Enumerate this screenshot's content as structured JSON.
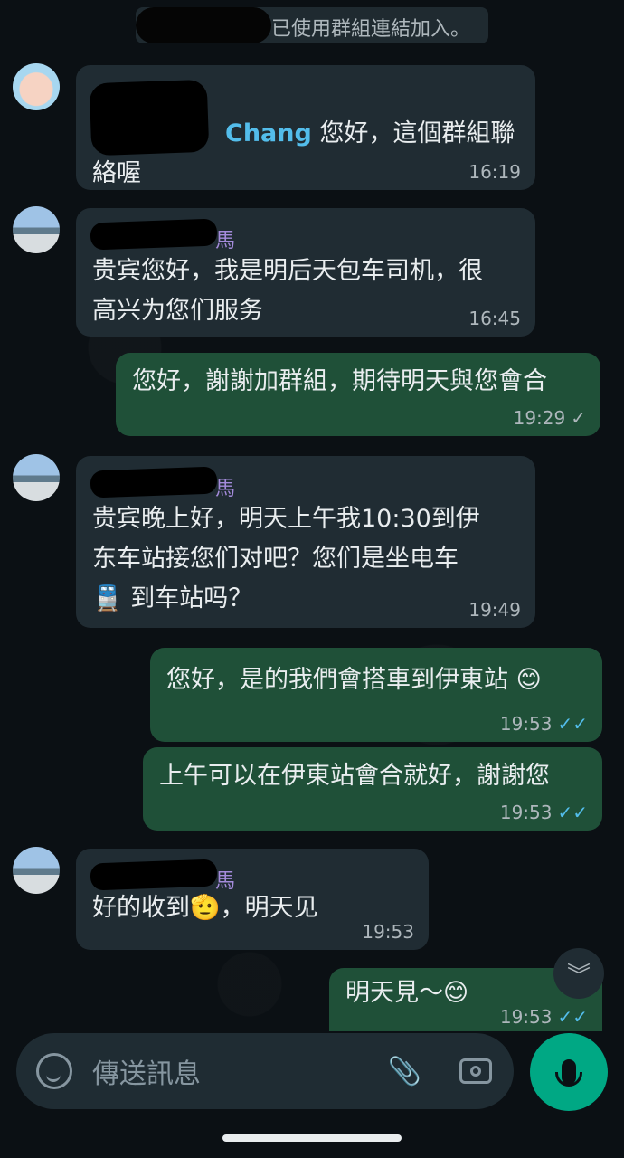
{
  "system_note": {
    "text": "已使用群組連結加入。"
  },
  "messages": [
    {
      "id": "m1",
      "direction": "incoming",
      "sender_suffix": "",
      "mention": "Chang",
      "text_lines": [
        "您好，這個群組聯",
        "絡喔"
      ],
      "time": "16:19"
    },
    {
      "id": "m2",
      "direction": "incoming",
      "sender_suffix": "馬",
      "text_lines": [
        "贵宾您好，我是明后天包车司机，很",
        "高兴为您们服务"
      ],
      "time": "16:45"
    },
    {
      "id": "m3",
      "direction": "outgoing",
      "text_lines": [
        "您好，謝謝加群組，期待明天與您會合"
      ],
      "time": "19:29",
      "status": "sent"
    },
    {
      "id": "m4",
      "direction": "incoming",
      "sender_suffix": "馬",
      "text_lines": [
        "贵宾晚上好，明天上午我10:30到伊",
        "东车站接您们对吧？您们是坐电车",
        "🚆 到车站吗？"
      ],
      "time": "19:49"
    },
    {
      "id": "m5",
      "direction": "outgoing",
      "text_lines": [
        "您好，是的我們會搭車到伊東站 😊"
      ],
      "time": "19:53",
      "status": "read"
    },
    {
      "id": "m6",
      "direction": "outgoing",
      "text_lines": [
        "上午可以在伊東站會合就好，謝謝您"
      ],
      "time": "19:53",
      "status": "read"
    },
    {
      "id": "m7",
      "direction": "incoming",
      "sender_suffix": "馬",
      "text_lines": [
        "好的收到🫡，明天见"
      ],
      "time": "19:53"
    },
    {
      "id": "m8",
      "direction": "outgoing",
      "text_lines": [
        "明天見～😊"
      ],
      "time": "19:53",
      "status": "read"
    }
  ],
  "composer": {
    "placeholder": "傳送訊息",
    "icons": [
      "sticker-icon",
      "paperclip-icon",
      "camera-icon",
      "microphone-icon"
    ]
  },
  "scroll_down_icon": "double-chevron-down-icon",
  "colors": {
    "background": "#0b1014",
    "incoming_bubble": "#202c33",
    "outgoing_bubble": "#1f5038",
    "sender_name": "#a48bdb",
    "mention": "#53bdeb",
    "read_tick": "#53bdeb",
    "mic_button": "#00a884"
  }
}
